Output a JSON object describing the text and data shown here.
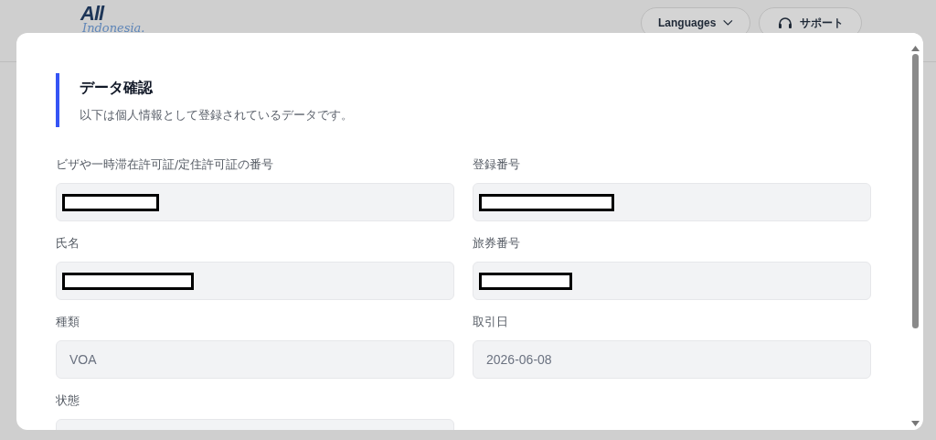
{
  "header": {
    "logo": {
      "primary": "All",
      "secondary": "Indonesia."
    },
    "language_button": "Languages",
    "support_button": "サポート"
  },
  "dialog": {
    "title": "データ確認",
    "subtitle": "以下は個人情報として登録されているデータです。",
    "fields": [
      {
        "label": "ビザや一時滞在許可証/定住許可証の番号",
        "redacted": true
      },
      {
        "label": "登録番号",
        "redacted": true
      },
      {
        "label": "氏名",
        "redacted": true
      },
      {
        "label": "旅券番号",
        "redacted": true
      },
      {
        "label": "種類",
        "value": "VOA",
        "redacted": false
      },
      {
        "label": "取引日",
        "value": "2026-06-08",
        "redacted": false
      },
      {
        "label": "状態",
        "redacted": false
      }
    ]
  }
}
